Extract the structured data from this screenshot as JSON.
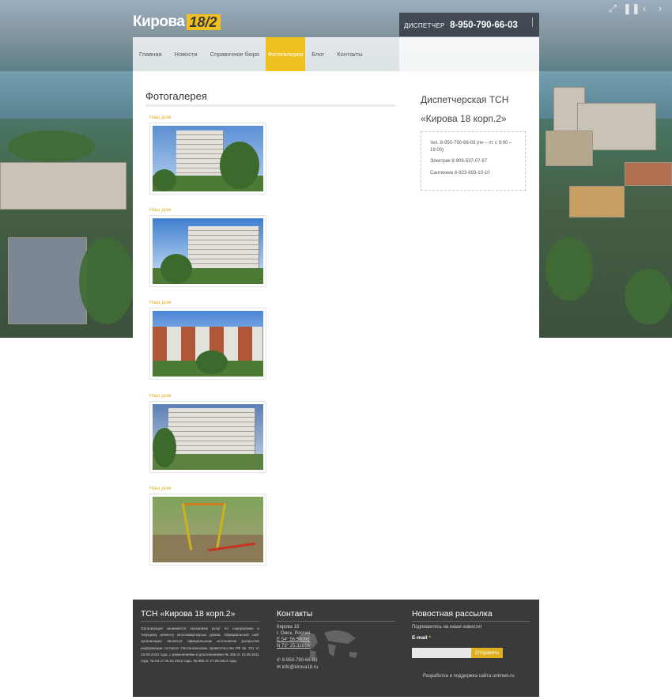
{
  "header": {
    "logo_text": "Кирова",
    "logo_badge": "18/2",
    "dispatcher_label": "ДИСПЕТЧЕР",
    "dispatcher_phone": "8-950-790-66-03"
  },
  "nav": {
    "items": [
      {
        "label": "Главная"
      },
      {
        "label": "Новости"
      },
      {
        "label": "Справочное бюро"
      },
      {
        "label": "Фотогалерея"
      },
      {
        "label": "Блог"
      },
      {
        "label": "Контакты"
      }
    ],
    "active_index": 3
  },
  "slider_controls": [
    "fullscreen-icon",
    "pause-icon",
    "prev-icon",
    "next-icon"
  ],
  "main": {
    "title": "Фотогалерея",
    "gallery": [
      {
        "caption": "Наш дом"
      },
      {
        "caption": "Наш дом"
      },
      {
        "caption": "Наш дом"
      },
      {
        "caption": "Наш дом"
      },
      {
        "caption": "Наш дом"
      }
    ]
  },
  "sidebar": {
    "title": "Диспетчерская ТСН «Кирова 18 корп.2»",
    "lines": [
      "тел. 8-950-790-66-03 (пн – пт с 9:00 – 19:00)",
      "Электрик 8-909-537-07-97",
      "Сантехник 8-923-693-10-10"
    ]
  },
  "footer": {
    "col1_title": "ТСН «Кирова 18 корп.2»",
    "col1_text": "Организация занимается оказанием услуг по содержанию и текущему ремонту многоквартирных домов. Официальный сайт организации является официальным источником раскрытия информации согласно Постановлению правительства РФ № 731 от 23.09.2010 года, с изменениями и дополнениями № 459 от 10.06.2011 года, № 94 от 06.02.2012 года, № 988 от 27.09.2014 года.",
    "col2_title": "Контакты",
    "address_line1": "Кирова 18",
    "address_line2": "г. Омск, Россия",
    "coord_e": "E 54° 56.58066'",
    "coord_n": "N 73° 25.32816'",
    "phone": "8-950-790-66-03",
    "email": "info@kirova18.ru",
    "col3_title": "Новостная рассылка",
    "subscribe_text": "Подпишитесь на наши новости!",
    "email_label": "E-mail",
    "email_required": "*",
    "submit_label": "Отправить",
    "dev_text": "Разработка и поддержка сайта unknwn.ru"
  },
  "colors": {
    "accent": "#f0c020",
    "footer_bg": "#3a3a3a"
  }
}
